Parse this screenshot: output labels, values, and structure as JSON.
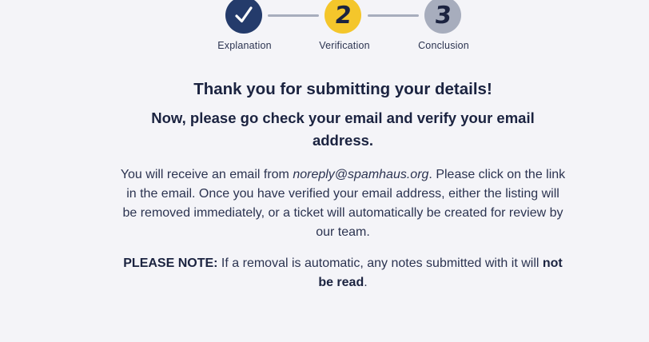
{
  "stepper": {
    "steps": [
      {
        "label": "Explanation",
        "icon": "checkmark-icon",
        "state": "completed",
        "color": "#243b6b"
      },
      {
        "label": "Verification",
        "number": "2",
        "state": "current",
        "color": "#f4c62b"
      },
      {
        "label": "Conclusion",
        "number": "3",
        "state": "upcoming",
        "color": "#a7adbd"
      }
    ],
    "connector_color": "#a7adbd"
  },
  "content": {
    "title": "Thank you for submitting your details!",
    "subtitle": "Now, please go check your email and verify your email address.",
    "body_before_email": "You will receive an email from ",
    "email": "noreply@spamhaus.org",
    "body_after_email": ". Please click on the link in the email. Once you have verified your email address, either the listing will be removed immediately, or a ticket will automatically be created for review by our team.",
    "note_label": "PLEASE NOTE:",
    "note_text": " If a removal is automatic, any notes submitted with it will ",
    "note_emphasis": "not be read",
    "note_end": "."
  }
}
